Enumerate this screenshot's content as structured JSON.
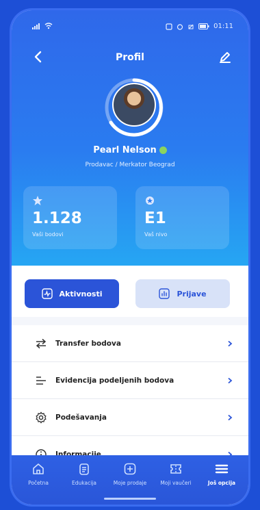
{
  "status": {
    "time": "01:11"
  },
  "header": {
    "title": "Profil"
  },
  "profile": {
    "name": "Pearl Nelson",
    "subtitle": "Prodavac / Merkator Beograd"
  },
  "stats": [
    {
      "value": "1.128",
      "label": "Vaši bodovi",
      "icon": "star-icon"
    },
    {
      "value": "E1",
      "label": "Vaš nivo",
      "icon": "badge-icon"
    }
  ],
  "tabs": [
    {
      "label": "Aktivnosti",
      "active": true,
      "icon": "activity-icon"
    },
    {
      "label": "Prijave",
      "active": false,
      "icon": "chart-icon"
    }
  ],
  "menu": [
    {
      "label": "Transfer bodova",
      "icon": "transfer-icon"
    },
    {
      "label": "Evidencija podeljenih bodova",
      "icon": "list-icon"
    },
    {
      "label": "Podešavanja",
      "icon": "gear-icon"
    },
    {
      "label": "Informacije",
      "icon": "info-icon"
    }
  ],
  "bottom_nav": [
    {
      "label": "Početna",
      "icon": "home-icon"
    },
    {
      "label": "Edukacija",
      "icon": "book-icon"
    },
    {
      "label": "Moje prodaje",
      "icon": "add-icon"
    },
    {
      "label": "Moji vaučeri",
      "icon": "voucher-icon"
    },
    {
      "label": "Još opcija",
      "icon": "menu-icon",
      "active": true
    }
  ],
  "colors": {
    "primary": "#2b54d8",
    "hero_top": "#2f68ea",
    "hero_bottom": "#26a6f3",
    "verified": "#8bd35f"
  }
}
